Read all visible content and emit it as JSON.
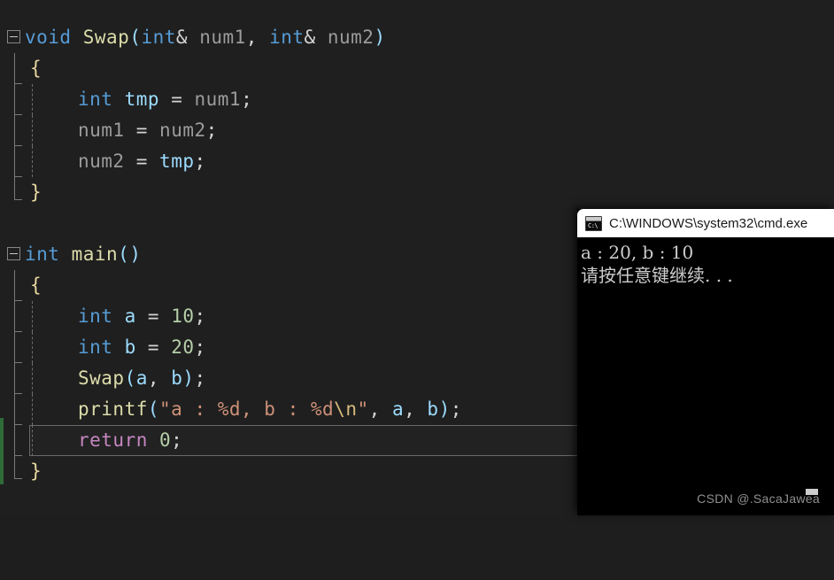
{
  "editor": {
    "background": "#1f1f1f",
    "change_bar_color": "#2f6b36",
    "lines": [
      {
        "indent": 0,
        "fold": true,
        "text": "void Swap(int& num1, int& num2)"
      },
      {
        "indent": 0,
        "fold": false,
        "text": "{"
      },
      {
        "indent": 1,
        "fold": false,
        "text": "int tmp = num1;"
      },
      {
        "indent": 1,
        "fold": false,
        "text": "num1 = num2;"
      },
      {
        "indent": 1,
        "fold": false,
        "text": "num2 = tmp;"
      },
      {
        "indent": 0,
        "fold": false,
        "text": "}"
      },
      {
        "indent": 0,
        "fold": false,
        "text": ""
      },
      {
        "indent": 0,
        "fold": true,
        "text": "int main()"
      },
      {
        "indent": 0,
        "fold": false,
        "text": "{"
      },
      {
        "indent": 1,
        "fold": false,
        "text": "int a = 10;"
      },
      {
        "indent": 1,
        "fold": false,
        "text": "int b = 20;"
      },
      {
        "indent": 1,
        "fold": false,
        "text": "Swap(a, b);"
      },
      {
        "indent": 1,
        "fold": false,
        "text": "printf(\"a : %d, b : %d\\n\", a, b);",
        "selected": true
      },
      {
        "indent": 1,
        "fold": false,
        "text": "return 0;"
      },
      {
        "indent": 0,
        "fold": false,
        "text": "}"
      }
    ],
    "colors": {
      "keyword": "#569cd6",
      "control": "#c586c0",
      "function": "#dcdcaa",
      "variable": "#9cdcfe",
      "parameter": "#9b9b9b",
      "number": "#b5cea8",
      "string": "#ce9178",
      "escape": "#d7ba7d",
      "punctuation": "#d4d4d4"
    }
  },
  "console": {
    "title": "C:\\WINDOWS\\system32\\cmd.exe",
    "icon": "cmd-icon",
    "prompt_glyph": "C:\\",
    "output": [
      "a : 20, b : 10",
      "请按任意键继续. . ."
    ],
    "background": "#000000",
    "text_color": "#cccccc"
  },
  "watermark": {
    "text": "CSDN @.SacaJawea"
  }
}
